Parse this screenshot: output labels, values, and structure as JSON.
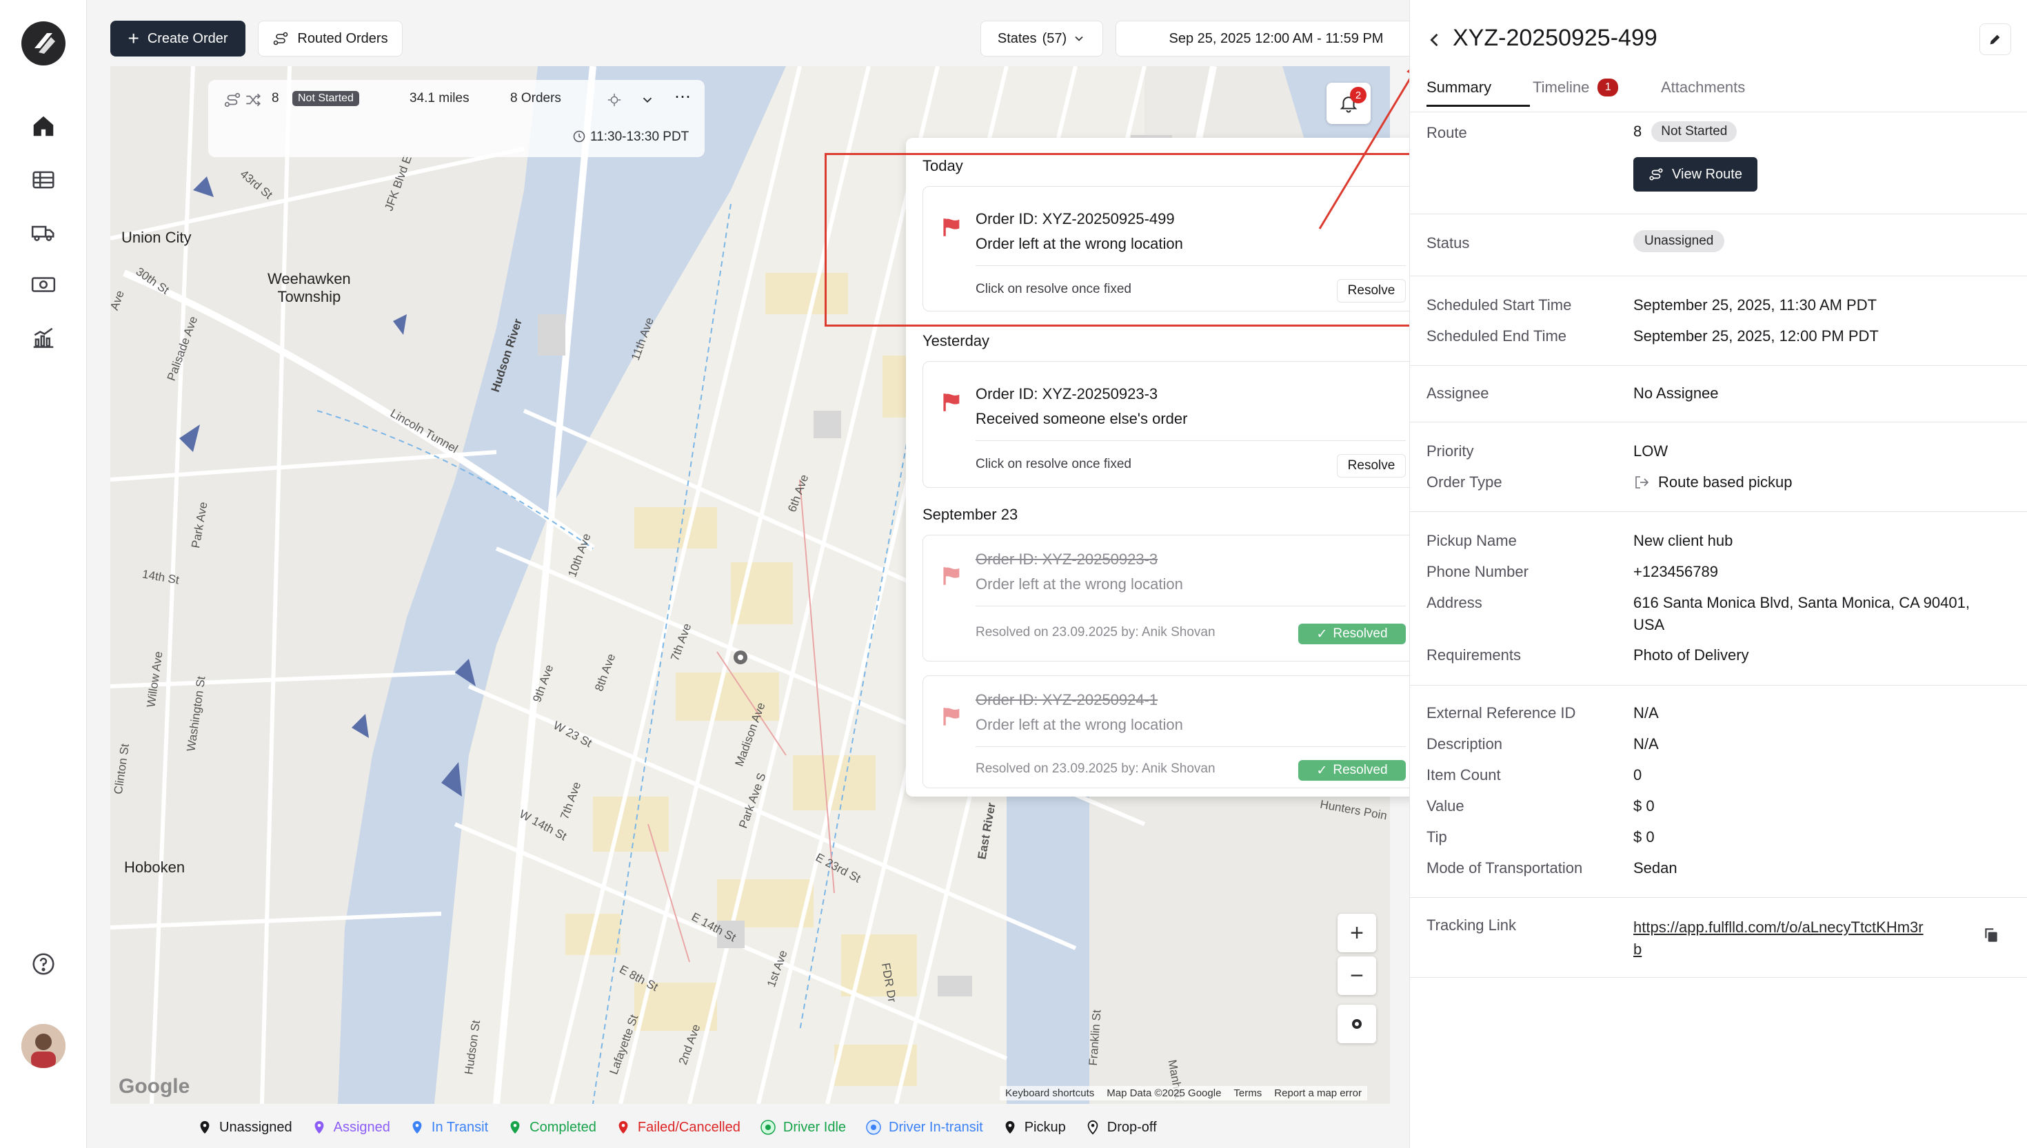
{
  "toolbar": {
    "create_order_label": "Create Order",
    "routed_orders_label": "Routed Orders",
    "states_label": "States",
    "states_count": "(57)",
    "date_range": "Sep 25, 2025 12:00 AM - 11:59 PM"
  },
  "route_card": {
    "route_number": "8",
    "status": "Not Started",
    "distance": "34.1 miles",
    "orders": "8 Orders",
    "time_window": "11:30-13:30 PDT"
  },
  "notifications": {
    "badge_count": "2",
    "groups": [
      {
        "title": "Today",
        "items": [
          {
            "order_id": "Order ID: XYZ-20250925-499",
            "message": "Order left at the wrong location",
            "hint": "Click on resolve once fixed",
            "action": "Resolve"
          }
        ]
      },
      {
        "title": "Yesterday",
        "items": [
          {
            "order_id": "Order ID: XYZ-20250923-3",
            "message": "Received someone else's order",
            "hint": "Click on resolve once fixed",
            "action": "Resolve"
          }
        ]
      },
      {
        "title": "September 23",
        "items": [
          {
            "order_id": "Order ID: XYZ-20250923-3",
            "message": "Order left at the wrong location",
            "hint": "Resolved on 23.09.2025 by: Anik Shovan",
            "status": "Resolved"
          },
          {
            "order_id": "Order ID: XYZ-20250924-1",
            "message": "Order left at the wrong location",
            "hint": "Resolved on 23.09.2025 by: Anik Shovan",
            "status": "Resolved"
          }
        ]
      }
    ]
  },
  "map": {
    "labels": {
      "union_city": "Union City",
      "weehawken": "Weehawken\nTownship",
      "hoboken": "Hoboken",
      "hudson_river": "Hudson River",
      "lincoln_tunnel": "Lincoln Tunnel",
      "east_river": "East River",
      "s43": "43rd St",
      "s30": "30th St",
      "s14": "14th St",
      "jfk": "JFK Blvd E",
      "palisade": "Palisade Ave",
      "park_ave": "Park Ave",
      "willow": "Willow Ave",
      "washington": "Washington St",
      "clinton": "Clinton St",
      "a11": "11th Ave",
      "a10": "10th Ave",
      "a9": "9th Ave",
      "a8": "8th Ave",
      "a7": "7th Ave",
      "a7b": "7th Ave",
      "a6": "6th Ave",
      "w23": "W 23 St",
      "w14": "W 14th St",
      "madison": "Madison Ave",
      "park_s": "Park Ave S",
      "e23": "E 23rd St",
      "e14": "E 14th St",
      "e8": "E 8th St",
      "first_ave": "1st Ave",
      "second_ave": "2nd Ave",
      "lafayette": "Lafayette St",
      "hudson_st": "Hudson St",
      "fdr": "FDR Dr",
      "franklin": "Franklin St",
      "manhattan": "Manhat",
      "hunters": "Hunters Poin",
      "ave_frag": "Ave"
    },
    "google_logo": "Google",
    "attribution": [
      "Keyboard shortcuts",
      "Map Data ©2025 Google",
      "Terms",
      "Report a map error"
    ]
  },
  "legend": [
    {
      "label": "Unassigned",
      "color": "#18181b"
    },
    {
      "label": "Assigned",
      "color": "#8b5cf6"
    },
    {
      "label": "In Transit",
      "color": "#3b82f6"
    },
    {
      "label": "Completed",
      "color": "#16a34a"
    },
    {
      "label": "Failed/Cancelled",
      "color": "#dc2626"
    },
    {
      "label": "Driver Idle",
      "color": "#16a34a"
    },
    {
      "label": "Driver In-transit",
      "color": "#3b82f6"
    },
    {
      "label": "Pickup",
      "color": "#18181b"
    },
    {
      "label": "Drop-off",
      "color": "#18181b"
    }
  ],
  "detail": {
    "title": "XYZ-20250925-499",
    "tabs": [
      "Summary",
      "Timeline",
      "Attachments"
    ],
    "timeline_badge": "1",
    "route_label": "Route",
    "route_number": "8",
    "route_status": "Not Started",
    "view_route_label": "View Route",
    "status_label": "Status",
    "status_value": "Unassigned",
    "sched_start_label": "Scheduled Start Time",
    "sched_start_value": "September 25, 2025, 11:30 AM PDT",
    "sched_end_label": "Scheduled End Time",
    "sched_end_value": "September 25, 2025, 12:00 PM PDT",
    "assignee_label": "Assignee",
    "assignee_value": "No Assignee",
    "priority_label": "Priority",
    "priority_value": "LOW",
    "order_type_label": "Order Type",
    "order_type_value": "Route based pickup",
    "pickup_name_label": "Pickup Name",
    "pickup_name_value": "New client hub",
    "phone_label": "Phone Number",
    "phone_value": "+123456789",
    "address_label": "Address",
    "address_line1": "616 Santa Monica Blvd, Santa Monica, CA 90401,",
    "address_line2": "USA",
    "requirements_label": "Requirements",
    "requirements_value": "Photo of Delivery",
    "ext_ref_label": "External Reference ID",
    "ext_ref_value": "N/A",
    "description_label": "Description",
    "description_value": "N/A",
    "item_count_label": "Item Count",
    "item_count_value": "0",
    "value_label": "Value",
    "value_value": "$ 0",
    "tip_label": "Tip",
    "tip_value": "$ 0",
    "mode_label": "Mode of Transportation",
    "mode_value": "Sedan",
    "tracking_label": "Tracking Link",
    "tracking_line1": "https://app.fulflld.com/t/o/aLnecyTtctKHm3r",
    "tracking_line2": "b"
  },
  "colors": {
    "highlight_red": "#dc3b2f",
    "flag_red": "#e0474c",
    "resolved_green": "#5cb87a",
    "dark_button": "#1f2937",
    "timeline_badge": "#b91c1c"
  }
}
